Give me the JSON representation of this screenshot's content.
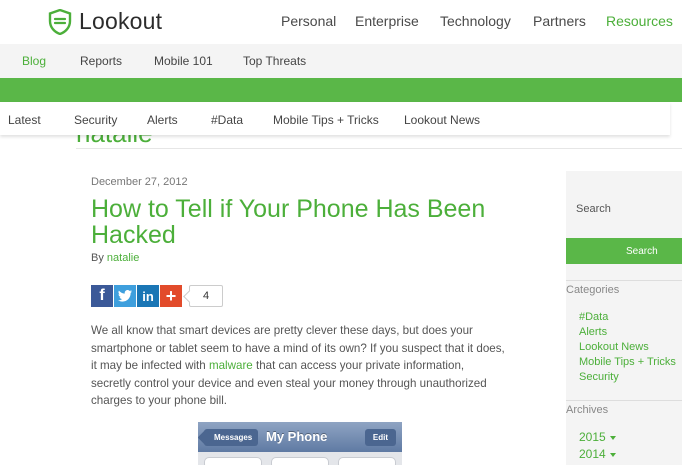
{
  "brand": {
    "name": "Lookout",
    "color": "#4caf3a",
    "logo_icon": "shield-logo-icon"
  },
  "top_nav": {
    "items": [
      "Personal",
      "Enterprise",
      "Technology",
      "Partners",
      "Resources"
    ],
    "active": "Resources"
  },
  "sub_nav": {
    "items": [
      "Blog",
      "Reports",
      "Mobile 101",
      "Top Threats"
    ],
    "active": "Blog"
  },
  "category_nav": {
    "items": [
      "Latest",
      "Security",
      "Alerts",
      "#Data",
      "Mobile Tips + Tricks",
      "Lookout News"
    ]
  },
  "author_heading": "natalie",
  "article": {
    "date": "December 27, 2012",
    "title": "How to Tell if Your Phone Has Been Hacked",
    "byline_prefix": "By",
    "author": "natalie",
    "share": {
      "icons": [
        "facebook-icon",
        "twitter-icon",
        "linkedin-icon",
        "google-plus-icon"
      ],
      "count": "4"
    },
    "body": {
      "before_link": "We all know that smart devices are pretty clever these days, but does your smartphone or tablet seem to have a mind of its own? If you suspect that it does, it may be infected with ",
      "link": "malware",
      "after_link": " that can access your private information, secretly control your device and even steal your money through unauthorized charges to your phone bill."
    },
    "phone_image": {
      "back": "Messages",
      "title": "My Phone",
      "edit": "Edit"
    }
  },
  "sidebar": {
    "search_placeholder": "Search",
    "search_button": "Search",
    "categories_heading": "Categories",
    "categories": [
      "#Data",
      "Alerts",
      "Lookout News",
      "Mobile Tips + Tricks",
      "Security"
    ],
    "archives_heading": "Archives",
    "archives": [
      "2015",
      "2014"
    ]
  },
  "colors": {
    "accent": "#4caf3a",
    "green_band": "#5ab748",
    "nav_bg": "#f4f4f4"
  }
}
